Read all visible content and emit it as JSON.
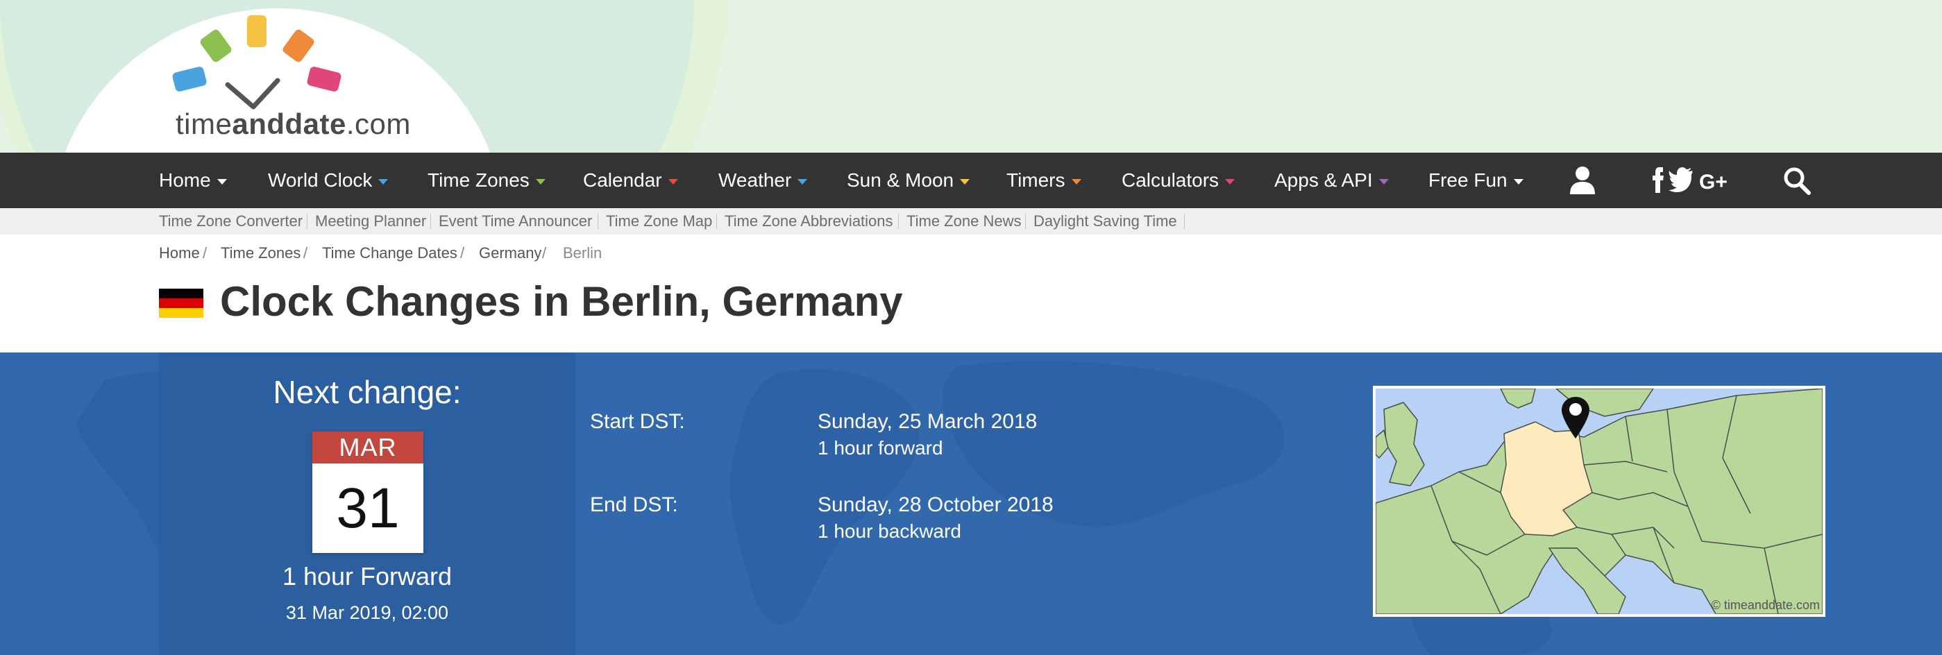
{
  "logo": {
    "text_time": "time",
    "text_and": "and",
    "text_date": "date",
    "text_tld": ".com",
    "colors": [
      "#4aa3df",
      "#8cc152",
      "#f5c242",
      "#ee8a3a",
      "#e0457b"
    ]
  },
  "nav": {
    "items": [
      {
        "label": "Home",
        "caret": "#ffffff"
      },
      {
        "label": "World Clock",
        "caret": "#4aa3df"
      },
      {
        "label": "Time Zones",
        "caret": "#8cc152"
      },
      {
        "label": "Calendar",
        "caret": "#e74c3c"
      },
      {
        "label": "Weather",
        "caret": "#4aa3df"
      },
      {
        "label": "Sun & Moon",
        "caret": "#f5c242"
      },
      {
        "label": "Timers",
        "caret": "#ee8a3a"
      },
      {
        "label": "Calculators",
        "caret": "#e0457b"
      },
      {
        "label": "Apps & API",
        "caret": "#a06ab4"
      },
      {
        "label": "Free Fun",
        "caret": "#ffffff"
      }
    ],
    "icons": [
      "user-icon",
      "facebook-icon",
      "twitter-icon",
      "google-plus-icon",
      "search-icon"
    ]
  },
  "subnav": {
    "items": [
      "Time Zone Converter",
      "Meeting Planner",
      "Event Time Announcer",
      "Time Zone Map",
      "Time Zone Abbreviations",
      "Time Zone News",
      "Daylight Saving Time"
    ]
  },
  "breadcrumb": {
    "items": [
      "Home",
      "Time Zones",
      "Time Change Dates",
      "Germany"
    ],
    "current": "Berlin",
    "separator": "/"
  },
  "page": {
    "title": "Clock Changes in Berlin, Germany",
    "flag_colors": [
      "#000000",
      "#dd0000",
      "#ffce00"
    ]
  },
  "next_change": {
    "label": "Next change:",
    "month": "MAR",
    "day": "31",
    "description": "1 hour Forward",
    "datetime": "31 Mar 2019, 02:00"
  },
  "dst": {
    "start": {
      "label": "Start DST:",
      "date": "Sunday, 25 March 2018",
      "detail": "1 hour forward"
    },
    "end": {
      "label": "End DST:",
      "date": "Sunday, 28 October 2018",
      "detail": "1 hour backward"
    }
  },
  "map": {
    "copyright": "© timeanddate.com",
    "sea_color": "#b7d2f4",
    "land_color": "#b8d79b",
    "highlight_color": "#fdebbd"
  },
  "theme": {
    "nav_bg": "#333333",
    "band_bg": "#3269ad"
  }
}
